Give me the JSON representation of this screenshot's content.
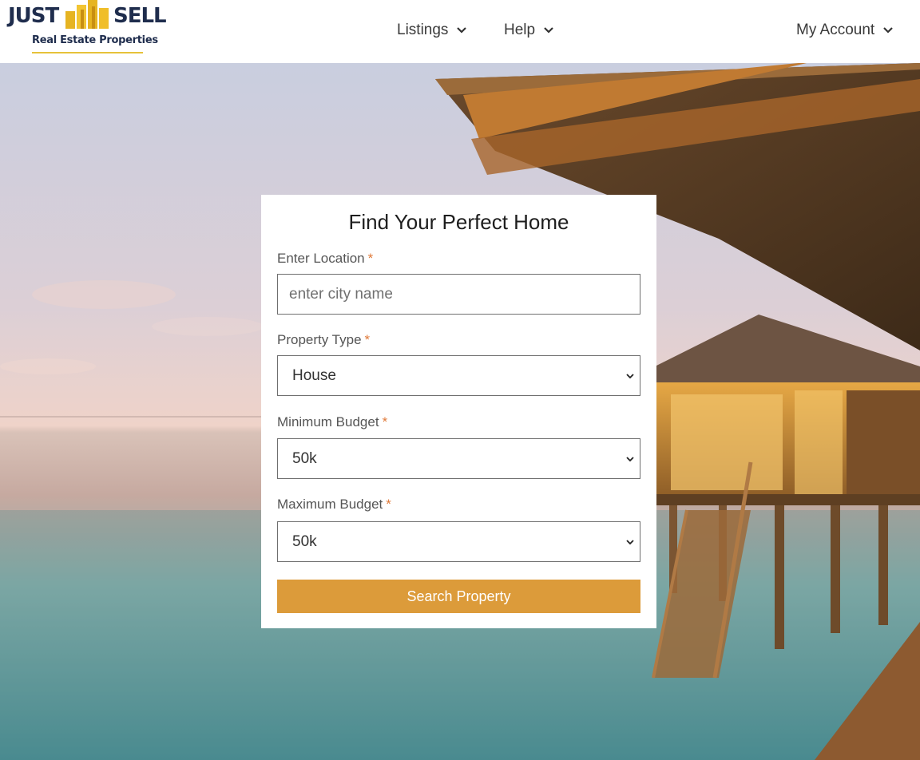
{
  "brand": {
    "name_left": "JUST",
    "name_right": "SELL",
    "tagline": "Real Estate Properties",
    "colors": {
      "navy": "#1f2d4d",
      "gold": "#e6b422"
    }
  },
  "nav": {
    "listings": "Listings",
    "help": "Help",
    "account": "My Account"
  },
  "search_form": {
    "title": "Find Your Perfect Home",
    "required_marker": "*",
    "location": {
      "label": "Enter Location",
      "placeholder": "enter city name",
      "value": ""
    },
    "property_type": {
      "label": "Property Type",
      "selected": "House"
    },
    "min_budget": {
      "label": "Minimum Budget",
      "selected": "50k"
    },
    "max_budget": {
      "label": "Maximum Budget",
      "selected": "50k"
    },
    "submit": "Search Property",
    "accent_color": "#dc9b3a"
  }
}
